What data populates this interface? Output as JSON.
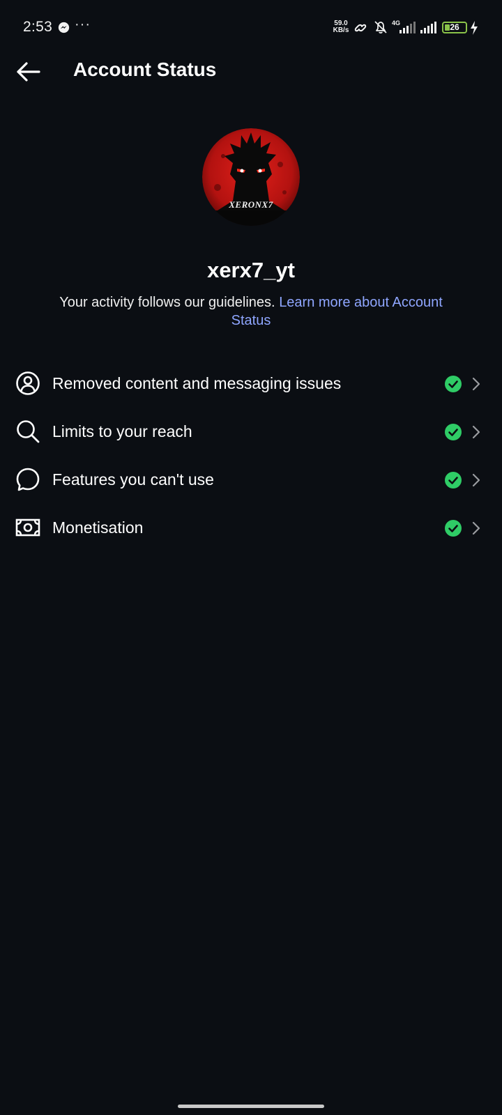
{
  "status_bar": {
    "time": "2:53",
    "more": "···",
    "speed_value": "59.0",
    "speed_unit": "KB/s",
    "network": "4G",
    "battery": "26",
    "battery_level": 0.26,
    "battery_color": "#8bc34a"
  },
  "header": {
    "title": "Account Status",
    "back_icon": "arrow-left-icon"
  },
  "profile": {
    "avatar_text": "XERONX7",
    "username": "xerx7_yt",
    "description": "Your activity follows our guidelines.",
    "learn_more": "Learn more about Account Status"
  },
  "items": [
    {
      "label": "Removed content and messaging issues",
      "icon": "user-circle-icon",
      "status": "ok"
    },
    {
      "label": "Limits to your reach",
      "icon": "search-icon",
      "status": "ok"
    },
    {
      "label": "Features you can't use",
      "icon": "speech-bubble-icon",
      "status": "ok"
    },
    {
      "label": "Monetisation",
      "icon": "money-icon",
      "status": "ok"
    }
  ],
  "colors": {
    "background": "#0b0e13",
    "link": "#8fa6ff",
    "check": "#2fcc66",
    "text": "#ffffff"
  }
}
